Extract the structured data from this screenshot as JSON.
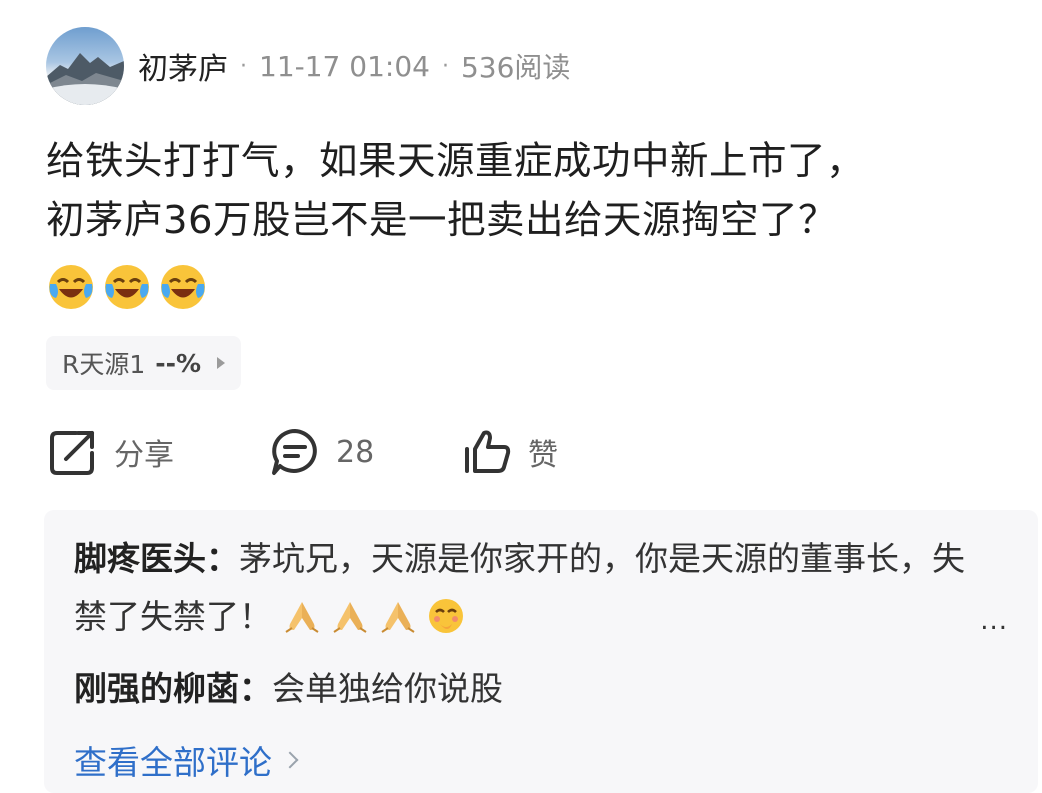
{
  "post": {
    "author": "初茅庐",
    "sep1": "·",
    "time": "11-17 01:04",
    "sep2": "·",
    "reads": "536阅读",
    "text": "给铁头打打气，如果天源重症成功中新上市了，\n初茅庐36万股岂不是一把卖出给天源掏空了？",
    "emojis": [
      "crying-laugh-emoji",
      "crying-laugh-emoji",
      "crying-laugh-emoji"
    ]
  },
  "stock_tag": {
    "name": "R天源1",
    "change": "--%"
  },
  "actions": {
    "share_label": "分享",
    "comment_count": "28",
    "like_label": "赞"
  },
  "comments": {
    "items": [
      {
        "author": "脚疼医头：",
        "text": "茅坑兄，天源是你家开的，你是天源的董事长，失禁了失禁了！",
        "emojis": [
          "praying-hands-emoji",
          "praying-hands-emoji",
          "praying-hands-emoji",
          "shy-face-emoji"
        ]
      },
      {
        "author": "刚强的柳菡：",
        "text": "会单独给你说股"
      }
    ],
    "more": "...",
    "view_all": "查看全部评论"
  },
  "colors": {
    "link": "#2f6fc9",
    "comment_bg": "#f7f7f9",
    "meta": "#8f8f8f"
  }
}
